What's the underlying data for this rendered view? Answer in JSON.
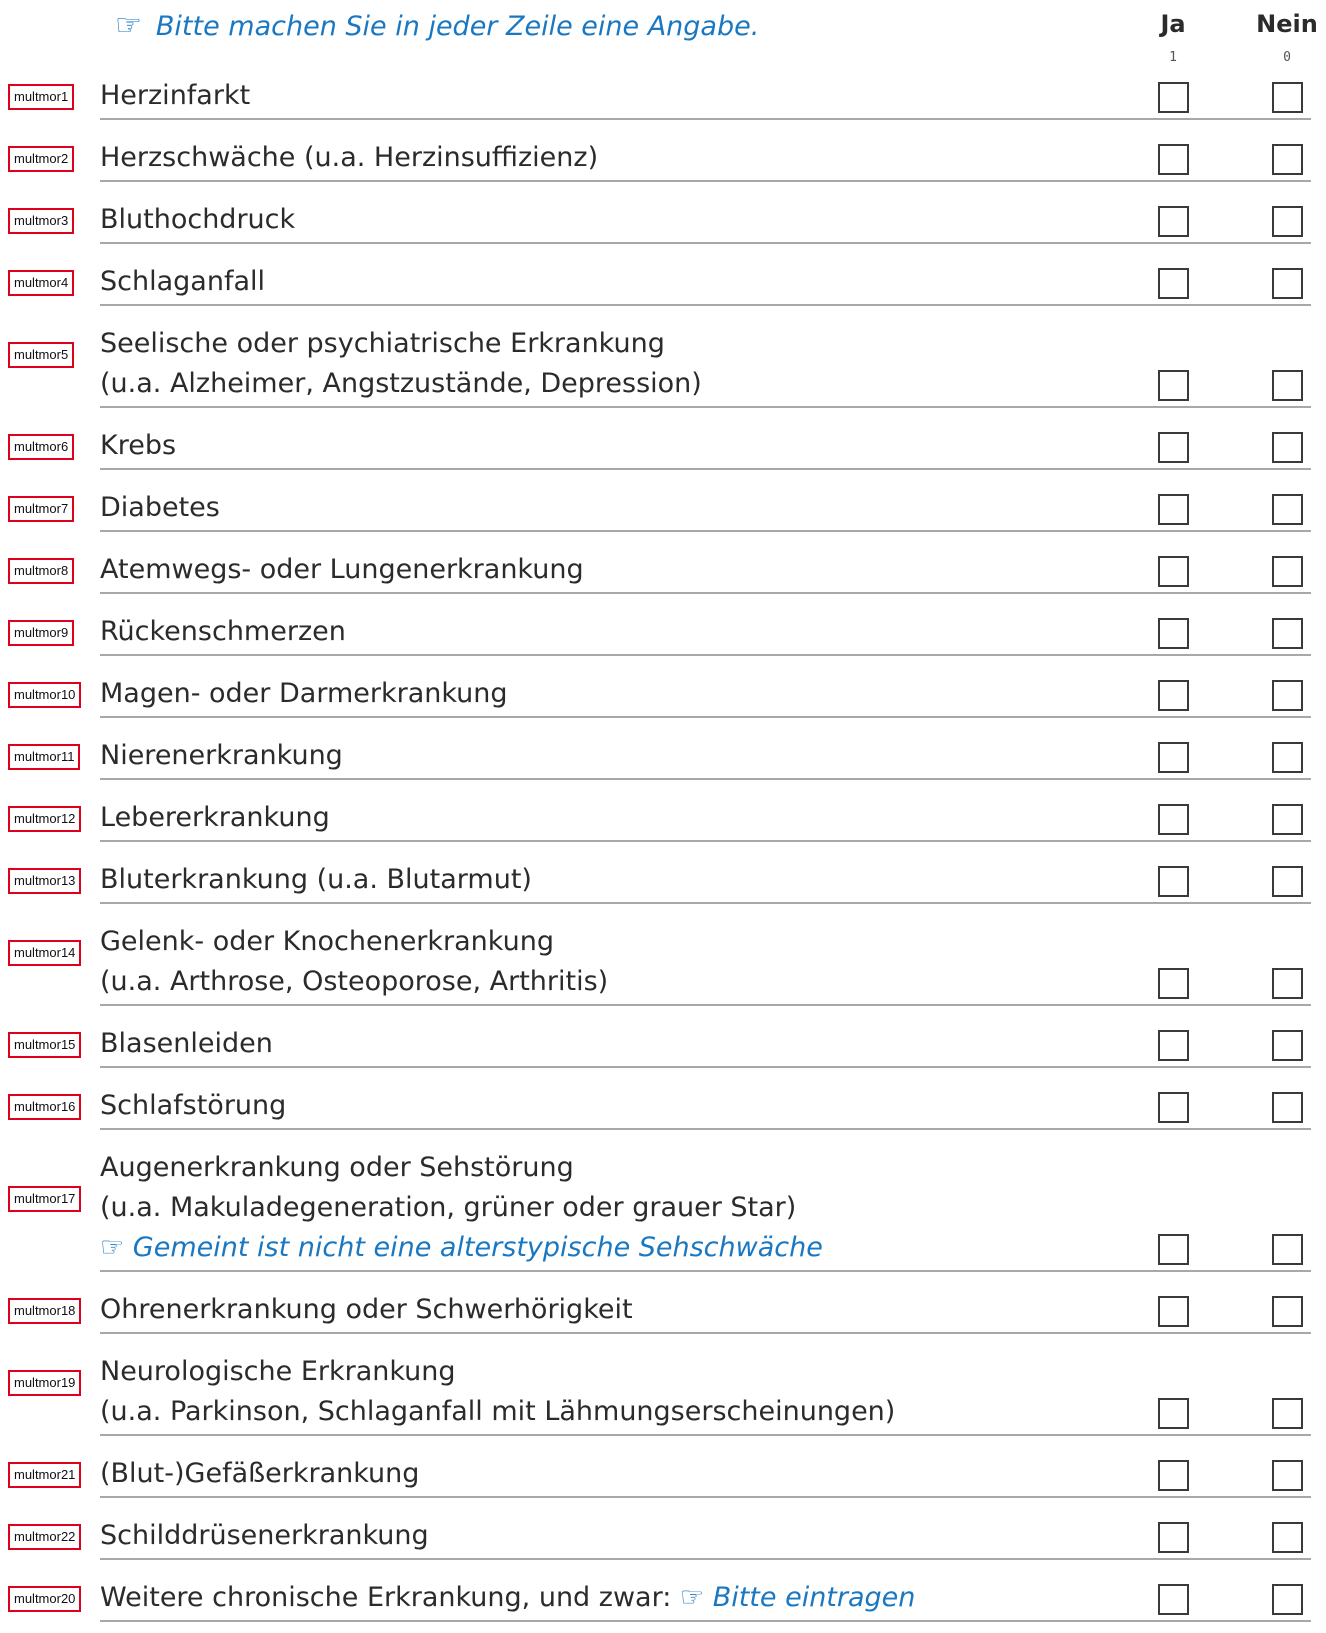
{
  "instruction": "Bitte machen Sie in jeder Zeile eine Angabe.",
  "hand_icon_glyph": "☞",
  "columns": [
    {
      "label": "Ja",
      "code": "1"
    },
    {
      "label": "Nein",
      "code": "0"
    }
  ],
  "rows": [
    {
      "var": "multmor1",
      "lines": [
        "Herzinfarkt"
      ]
    },
    {
      "var": "multmor2",
      "lines": [
        "Herzschwäche (u.a. Herzinsuffizienz)"
      ]
    },
    {
      "var": "multmor3",
      "lines": [
        "Bluthochdruck"
      ]
    },
    {
      "var": "multmor4",
      "lines": [
        "Schlaganfall"
      ]
    },
    {
      "var": "multmor5",
      "lines": [
        "Seelische oder psychiatrische Erkrankung",
        "(u.a. Alzheimer, Angstzustände, Depression)"
      ]
    },
    {
      "var": "multmor6",
      "lines": [
        "Krebs"
      ]
    },
    {
      "var": "multmor7",
      "lines": [
        "Diabetes"
      ]
    },
    {
      "var": "multmor8",
      "lines": [
        "Atemwegs- oder Lungenerkrankung"
      ]
    },
    {
      "var": "multmor9",
      "lines": [
        "Rückenschmerzen"
      ]
    },
    {
      "var": "multmor10",
      "lines": [
        "Magen- oder Darmerkrankung"
      ]
    },
    {
      "var": "multmor11",
      "lines": [
        "Nierenerkrankung"
      ]
    },
    {
      "var": "multmor12",
      "lines": [
        "Lebererkrankung"
      ]
    },
    {
      "var": "multmor13",
      "lines": [
        "Bluterkrankung (u.a. Blutarmut)"
      ]
    },
    {
      "var": "multmor14",
      "lines": [
        "Gelenk- oder Knochenerkrankung",
        "(u.a. Arthrose, Osteoporose, Arthritis)"
      ]
    },
    {
      "var": "multmor15",
      "lines": [
        "Blasenleiden"
      ]
    },
    {
      "var": "multmor16",
      "lines": [
        "Schlafstörung"
      ]
    },
    {
      "var": "multmor17",
      "lines": [
        "Augenerkrankung oder Sehstörung",
        "(u.a. Makuladegeneration, grüner oder grauer Star)"
      ],
      "hint": "Gemeint ist nicht eine alterstypische Sehschwäche"
    },
    {
      "var": "multmor18",
      "lines": [
        "Ohrenerkrankung oder Schwerhörigkeit"
      ]
    },
    {
      "var": "multmor19",
      "lines": [
        "Neurologische Erkrankung",
        "(u.a. Parkinson, Schlaganfall mit Lähmungserscheinungen)"
      ]
    },
    {
      "var": "multmor21",
      "lines": [
        "(Blut-)Gefäßerkrankung"
      ]
    },
    {
      "var": "multmor22",
      "lines": [
        "Schilddrüsenerkrankung"
      ]
    },
    {
      "var": "multmor20",
      "lines": [
        "Weitere chronische Erkrankung, und zwar:"
      ],
      "inline_hint": "Bitte eintragen"
    }
  ]
}
